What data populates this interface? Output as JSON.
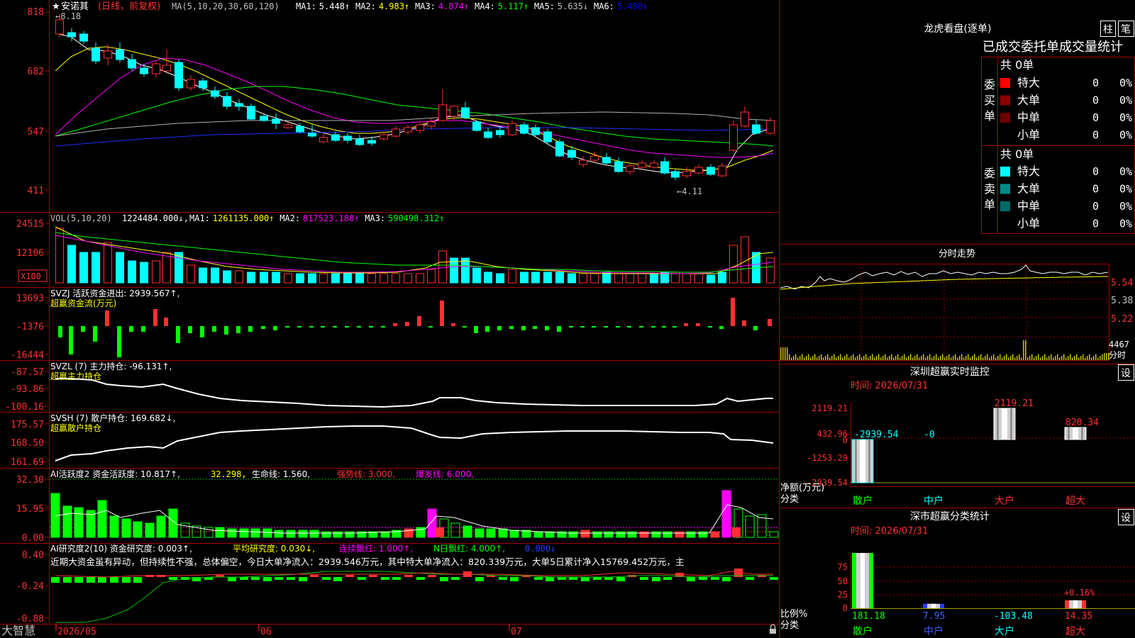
{
  "app": {
    "brand": "大智慧"
  },
  "main": {
    "star": "★",
    "stock_name": "安诺其",
    "period": "(日线，前复权)",
    "ma_params": "MA(5,10,20,30,60,120)",
    "ma_values": [
      {
        "label": "MA1:",
        "value": "5.448↑",
        "color": "#ffffff"
      },
      {
        "label": "MA2:",
        "value": "4.983↑",
        "color": "#ffff00"
      },
      {
        "label": "MA3:",
        "value": "4.874↑",
        "color": "#ff00ff"
      },
      {
        "label": "MA4:",
        "value": "5.117↑",
        "color": "#00ff00"
      },
      {
        "label": "MA5:",
        "value": "5.635↓",
        "color": "#c0c0c0"
      },
      {
        "label": "MA6:",
        "value": "5.480↑",
        "color": "#0000ff"
      }
    ],
    "y_ticks": [
      "818",
      "682",
      "547",
      "411"
    ],
    "high_mark": "←8.18",
    "low_mark": "←4.11",
    "dates": [
      "2026/05",
      "06",
      "07"
    ]
  },
  "vol": {
    "params": "VOL(5,10,20)",
    "value": "1224484.000↓,",
    "ma": [
      {
        "label": "MA1:",
        "value": "1261135.000↑",
        "color": "#ffff00"
      },
      {
        "label": "MA2:",
        "value": "817523.188↑",
        "color": "#ff00ff"
      },
      {
        "label": "MA3:",
        "value": "590498.312↑",
        "color": "#00ff00"
      }
    ],
    "y_ticks": [
      "24515",
      "12106"
    ],
    "unit": "X100"
  },
  "svzj": {
    "title": "SVZJ  活跃资金进出: 2939.567↑,",
    "sub": "超赢资金流(万元)",
    "y_ticks": [
      "13693",
      "-1376",
      "-16444"
    ]
  },
  "svzl": {
    "title": "SVZL (7) 主力持仓: -96.131↑,",
    "sub": "超赢主力持仓",
    "y_ticks": [
      "-87.57",
      "-93.86",
      "-100.16"
    ]
  },
  "svsh": {
    "title": "SVSH (7) 散户持仓: 169.682↓,",
    "sub": "超赢散户持仓",
    "y_ticks": [
      "175.57",
      "168.50",
      "161.69"
    ]
  },
  "ai1": {
    "title": "AI活跃度2 资金活跃度: 10.817↑,",
    "v2": "32.298,",
    "v3": "生命线: 1.560,",
    "v4": "强势线: 3.000,",
    "v5": "爆发线: 6.000,",
    "y_ticks": [
      "32.30",
      "15.95",
      "0.00"
    ]
  },
  "ai2": {
    "title": "AI研究度2(10) 资金研究度: 0.003↑,",
    "v2": "平均研究度: 0.030↓,",
    "v3": "连续飘红: 1.000↑,",
    "v4": "N日飘红: 4.000↑,",
    "v5": "0.000↓",
    "comment": "近期大资金虽有异动，但持续性不强，总体偏空，今日大单净流入：2939.546万元，其中特大单净流入：820.339万元，大单5日累计净入15769.452万元，主",
    "y_ticks": [
      "0.40",
      "-0.24",
      "-0.88"
    ]
  },
  "right": {
    "lhb_title": "龙虎看盘(逐单)",
    "tab_zhu": "柱",
    "tab_bi": "笔",
    "stats_header": "已成交委托单成交量统计",
    "buy_label": "委买单",
    "sell_label": "委卖单",
    "buy_total": "共 0单",
    "sell_total": "共 0单",
    "buy_rows": [
      {
        "name": "特大",
        "count": "0",
        "pct": "0%",
        "color": "#ff0000"
      },
      {
        "name": "大单",
        "count": "0",
        "pct": "0%",
        "color": "#8b0000"
      },
      {
        "name": "中单",
        "count": "0",
        "pct": "0%",
        "color": "#6b0000"
      },
      {
        "name": "小单",
        "count": "0",
        "pct": "0%",
        "color": ""
      }
    ],
    "sell_rows": [
      {
        "name": "特大",
        "count": "0",
        "pct": "0%",
        "color": "#00ffff"
      },
      {
        "name": "大单",
        "count": "0",
        "pct": "0%",
        "color": "#008b8b"
      },
      {
        "name": "中单",
        "count": "0",
        "pct": "0%",
        "color": "#006b6b"
      },
      {
        "name": "小单",
        "count": "0",
        "pct": "0%",
        "color": ""
      }
    ],
    "intraday": {
      "title": "分时走势",
      "y_ticks": [
        "5.54",
        "5.38",
        "5.22"
      ],
      "vol_label": "4467",
      "sub_label": "分时"
    },
    "sz_monitor": {
      "title": "深圳超赢实时监控",
      "set": "设",
      "time": "时间: 2026/07/31",
      "y_ticks": [
        "2119.21",
        "432.96",
        "0",
        "-1253.29",
        "-2939.54"
      ],
      "bar_values": [
        "-2939.54",
        "-0",
        "2119.21",
        "820.34"
      ],
      "y_unit": "净额(万元)",
      "x_unit": "分类",
      "cats": [
        "散户",
        "中户",
        "大户",
        "超大"
      ]
    },
    "sz_stats": {
      "title": "深市超赢分类统计",
      "set": "设",
      "time": "时间: 2026/07/31",
      "y_ticks": [
        "75",
        "50",
        "25",
        "0"
      ],
      "annotation": "+0.16%",
      "values": [
        "181.18",
        "7.95",
        "-103.48",
        "14.35"
      ],
      "y_unit": "比例%",
      "x_unit": "分类",
      "cats": [
        "散户",
        "中户",
        "大户",
        "超大"
      ]
    }
  },
  "chart_data": [
    {
      "type": "bar",
      "title": "深圳超赢实时监控",
      "categories": [
        "散户",
        "中户",
        "大户",
        "超大"
      ],
      "values": [
        -2939.54,
        0,
        2119.21,
        820.34
      ],
      "ylabel": "净额(万元)",
      "ylim": [
        -2939.54,
        2119.21
      ]
    },
    {
      "type": "bar",
      "title": "深市超赢分类统计",
      "categories": [
        "散户",
        "中户",
        "大户",
        "超大"
      ],
      "values": [
        181.18,
        7.95,
        -103.48,
        14.35
      ],
      "ylabel": "比例%"
    }
  ]
}
